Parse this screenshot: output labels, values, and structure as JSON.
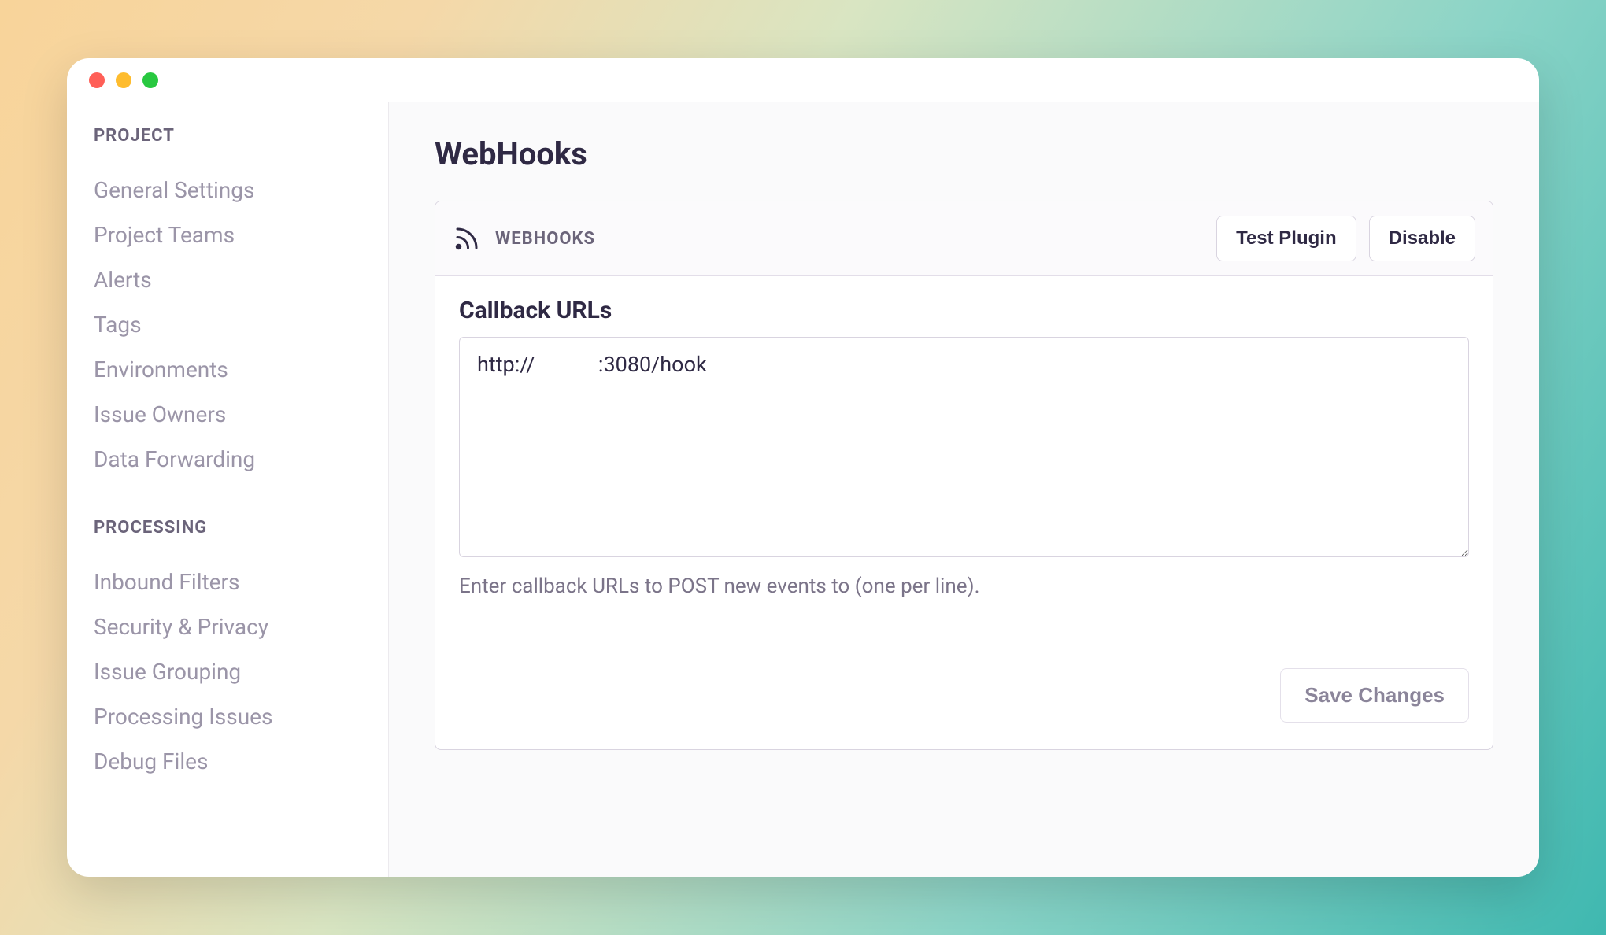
{
  "sidebar": {
    "sections": [
      {
        "header": "PROJECT",
        "items": [
          "General Settings",
          "Project Teams",
          "Alerts",
          "Tags",
          "Environments",
          "Issue Owners",
          "Data Forwarding"
        ]
      },
      {
        "header": "PROCESSING",
        "items": [
          "Inbound Filters",
          "Security & Privacy",
          "Issue Grouping",
          "Processing Issues",
          "Debug Files"
        ]
      }
    ]
  },
  "main": {
    "title": "WebHooks",
    "panel": {
      "header_label": "WEBHOOKS",
      "test_button": "Test Plugin",
      "disable_button": "Disable",
      "callback_label": "Callback URLs",
      "callback_value": "http://            :3080/hook",
      "callback_help": "Enter callback URLs to POST new events to (one per line).",
      "save_button": "Save Changes"
    }
  }
}
